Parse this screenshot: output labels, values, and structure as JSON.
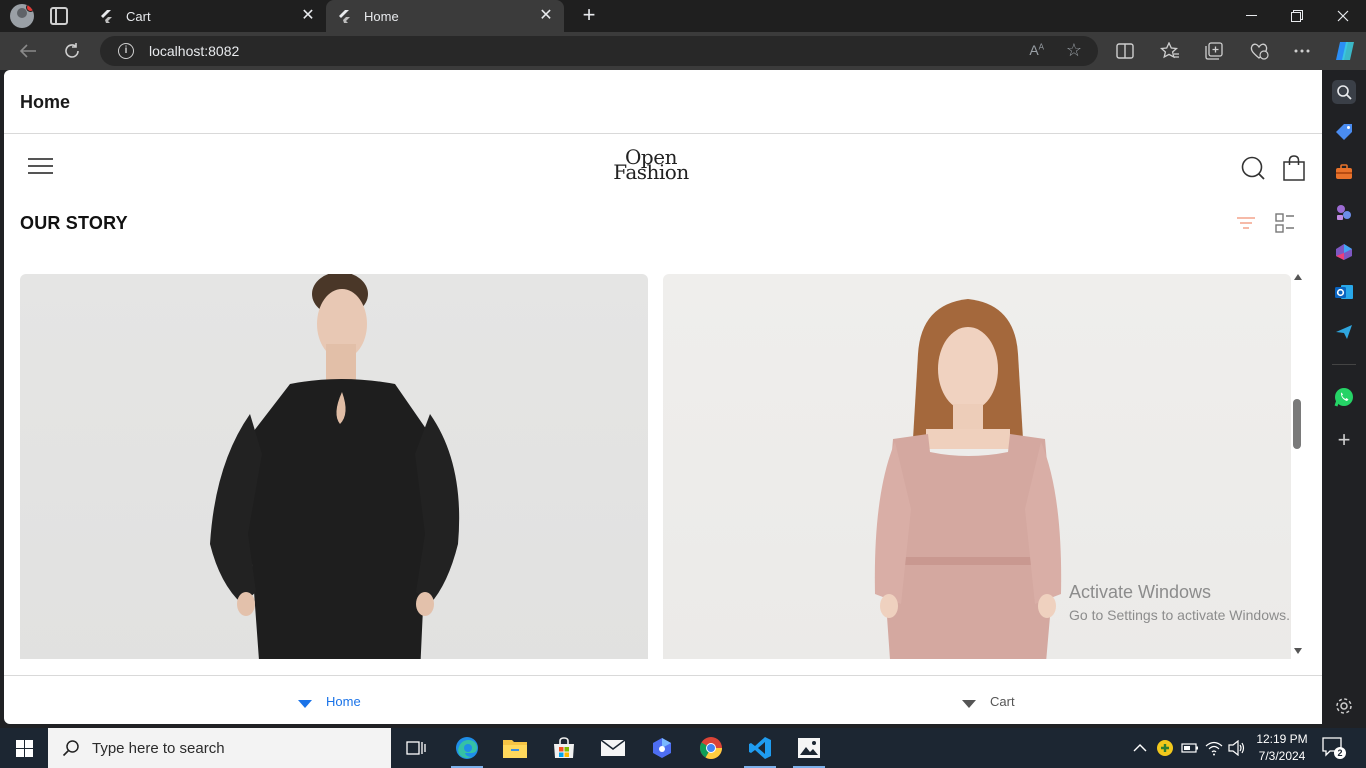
{
  "browser": {
    "tabs": [
      {
        "label": "Cart",
        "active": false
      },
      {
        "label": "Home",
        "active": true
      }
    ],
    "url": "localhost:8082"
  },
  "app": {
    "title": "Home",
    "brand": {
      "line1": "Open",
      "line2": "Fashion"
    },
    "section_title": "OUR STORY",
    "accent_color": "#f4a38b",
    "products": [
      {
        "name": "black-long-sleeve-dress",
        "color": "#1e1e1e"
      },
      {
        "name": "pink-square-neck-dress",
        "color": "#d4a8a0"
      }
    ],
    "bottom_nav": [
      {
        "label": "Home",
        "active": true
      },
      {
        "label": "Cart",
        "active": false
      }
    ]
  },
  "watermark": {
    "line1": "Activate Windows",
    "line2": "Go to Settings to activate Windows."
  },
  "taskbar": {
    "search_placeholder": "Type here to search",
    "time": "12:19 PM",
    "date": "7/3/2024",
    "notification_count": "2"
  }
}
